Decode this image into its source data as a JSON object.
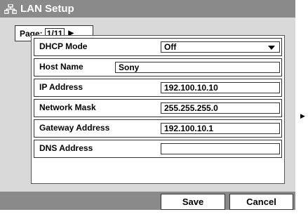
{
  "window": {
    "title": "LAN Setup",
    "title_icon": "network-icon"
  },
  "pagination": {
    "label": "Page:",
    "value": "1/11"
  },
  "fields": [
    {
      "label": "DHCP Mode",
      "value": "Off",
      "type": "dropdown"
    },
    {
      "label": "Host Name",
      "value": "Sony",
      "type": "text"
    },
    {
      "label": "IP Address",
      "value": "192.100.10.10",
      "type": "text"
    },
    {
      "label": "Network Mask",
      "value": "255.255.255.0",
      "type": "text"
    },
    {
      "label": "Gateway Address",
      "value": "192.100.10.1",
      "type": "text"
    },
    {
      "label": "DNS Address",
      "value": "",
      "type": "text"
    }
  ],
  "actions": {
    "save_label": "Save",
    "cancel_label": "Cancel"
  },
  "colors": {
    "title_bar": "#8a8a8a",
    "panel": "#d9d9d9"
  }
}
